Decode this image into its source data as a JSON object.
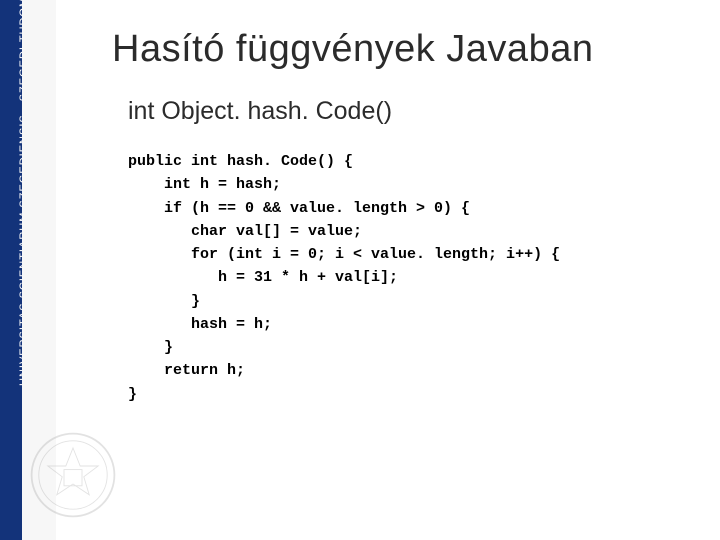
{
  "sidebar": {
    "institution": "UNIVERSITAS SCIENTIARUM SZEGEDIENSIS  •  SZEGEDI TUDOMÁNYEGYETEM"
  },
  "slide": {
    "title": "Hasító függvények Javaban",
    "subtitle": "int Object. hash. Code()",
    "code": "public int hash. Code() {\n    int h = hash;\n    if (h == 0 && value. length > 0) {\n       char val[] = value;\n       for (int i = 0; i < value. length; i++) {\n          h = 31 * h + val[i];\n       }\n       hash = h;\n    }\n    return h;\n}"
  }
}
